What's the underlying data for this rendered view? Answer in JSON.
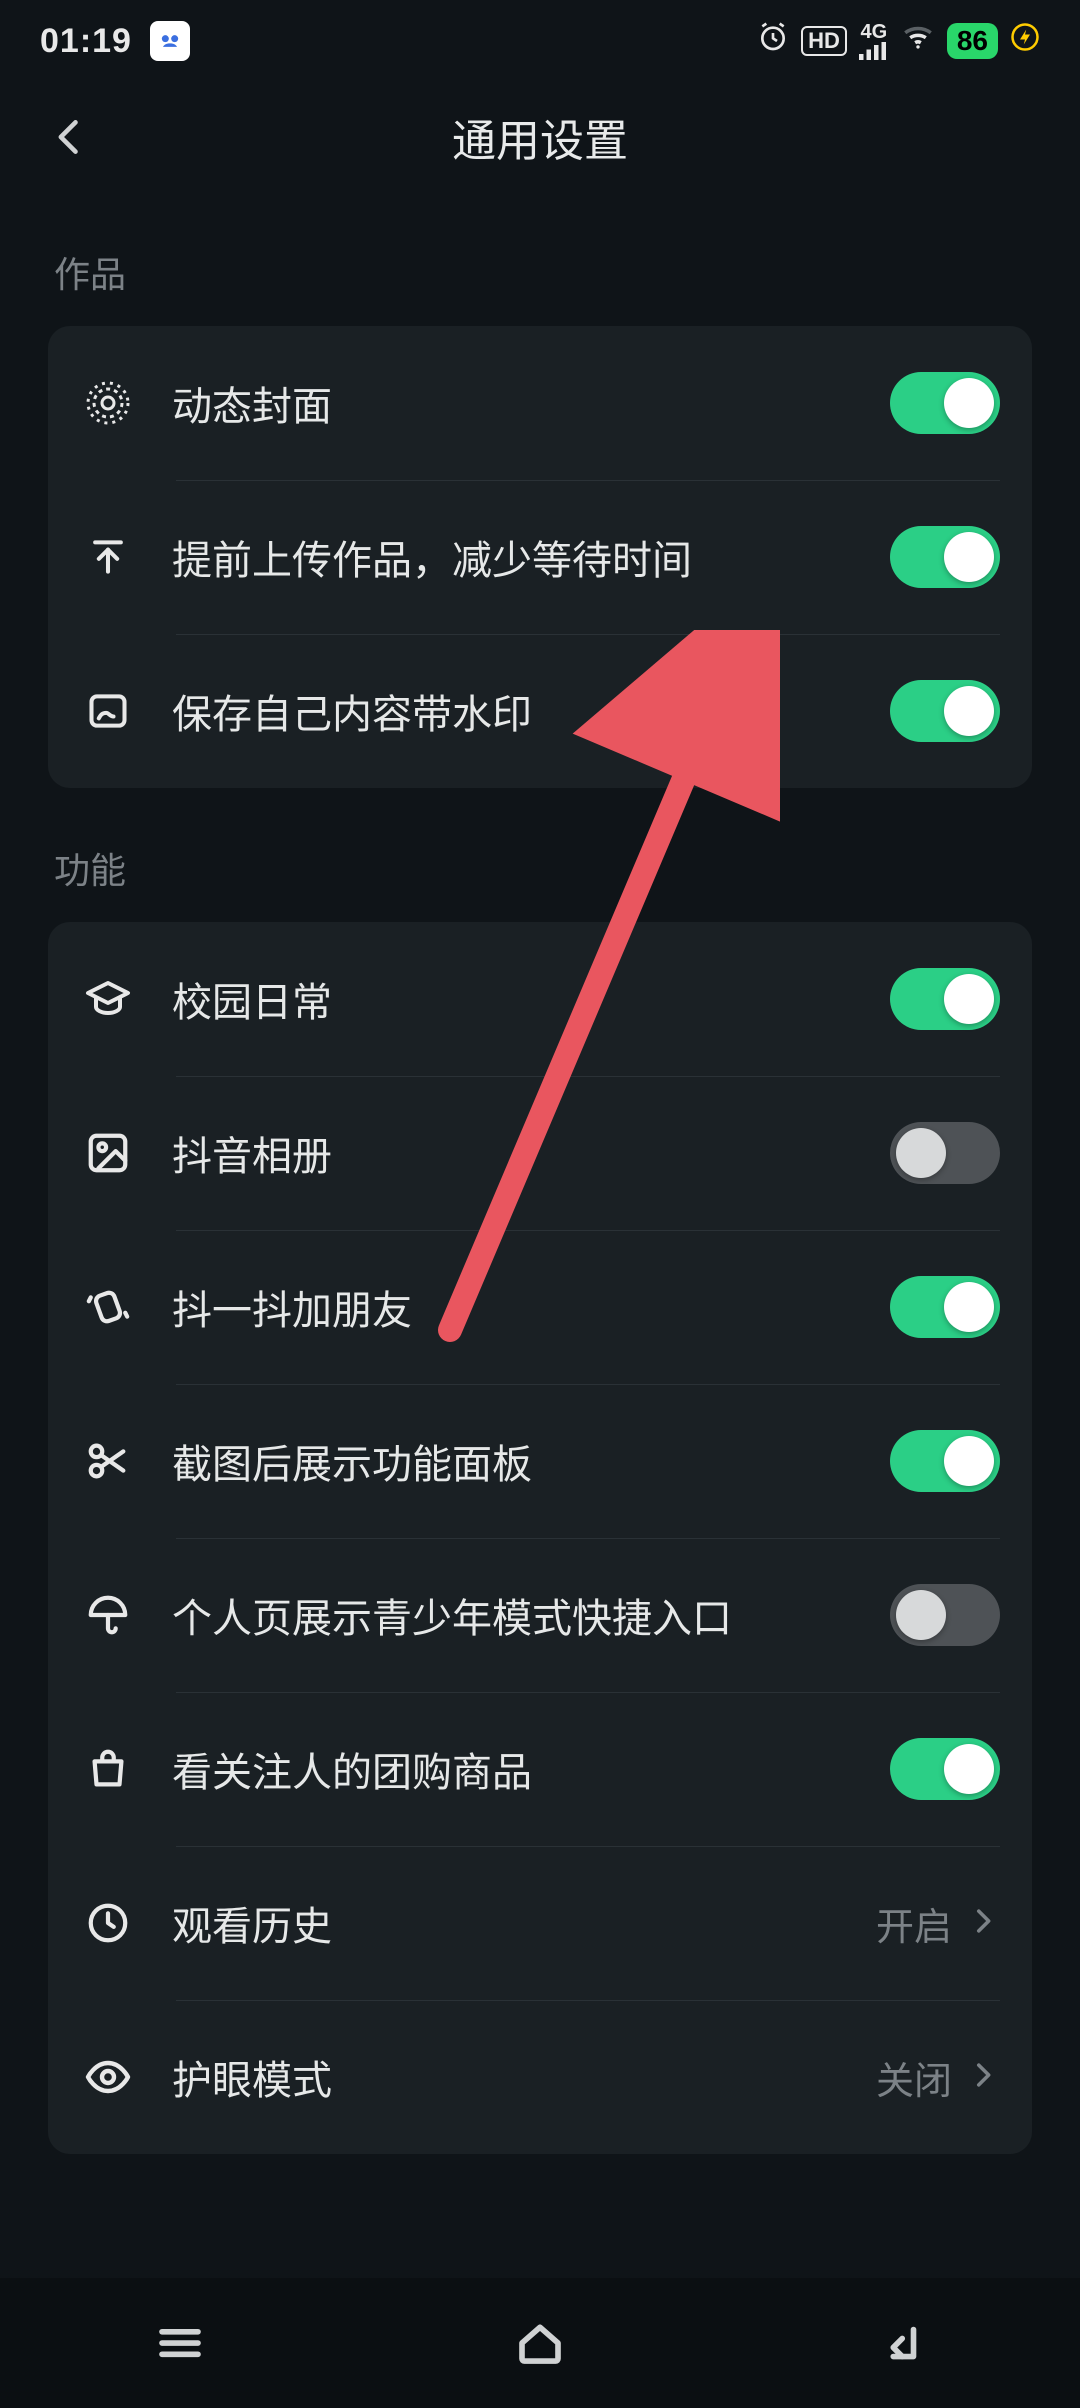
{
  "status_bar": {
    "time": "01:19",
    "network": "4G",
    "battery": "86"
  },
  "header": {
    "title": "通用设置"
  },
  "sections": {
    "works": {
      "header": "作品",
      "dynamic_cover": "动态封面",
      "pre_upload": "提前上传作品，减少等待时间",
      "save_watermark": "保存自己内容带水印"
    },
    "features": {
      "header": "功能",
      "campus": "校园日常",
      "album": "抖音相册",
      "shake": "抖一抖加朋友",
      "screenshot_panel": "截图后展示功能面板",
      "teen_mode": "个人页展示青少年模式快捷入口",
      "group_buy": "看关注人的团购商品",
      "history": {
        "label": "观看历史",
        "value": "开启"
      },
      "eye": {
        "label": "护眼模式",
        "value": "关闭"
      }
    }
  }
}
